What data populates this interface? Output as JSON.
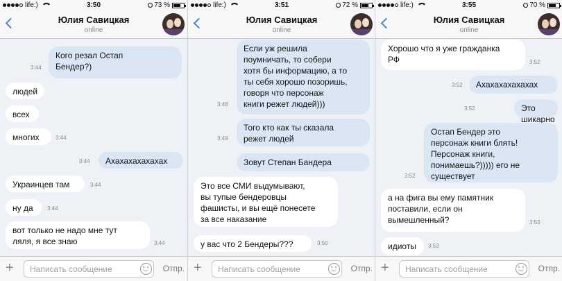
{
  "shared": {
    "contact_name": "Юлия Савицкая",
    "contact_status": "online",
    "carrier": "life:)",
    "input_placeholder": "Написать сообщение",
    "send_label": "Отпр.",
    "plus_glyph": "+",
    "icons": [
      "back-chevron-icon",
      "avatar",
      "add-attachment-icon",
      "emoji-icon",
      "wifi-icon",
      "lock-rotation-icon",
      "battery-icon"
    ],
    "colors": {
      "outgoing_bubble": "#dbe6f4",
      "incoming_bubble": "#ffffff",
      "chat_background": "#eef1f5",
      "accent": "#4a86c5"
    }
  },
  "screens": [
    {
      "clock": "3:50",
      "battery": "73 %",
      "battery_level": 0.73,
      "messages": [
        {
          "dir": "out",
          "text": "Кого резал Остап\nБендер?)",
          "time": "3:44"
        },
        {
          "dir": "in",
          "text": "людей",
          "time": ""
        },
        {
          "dir": "in",
          "text": "всех",
          "time": ""
        },
        {
          "dir": "in",
          "text": "многих",
          "time": "3:44"
        },
        {
          "dir": "out",
          "text": "Ахахахахахахах",
          "time": "3:44"
        },
        {
          "dir": "in",
          "text": "Украинцев там",
          "time": "3:44"
        },
        {
          "dir": "in",
          "text": "ну да",
          "time": "3:44"
        },
        {
          "dir": "in",
          "text": "вот только не надо мне тут\nляля, я все знаю",
          "time": "3:44"
        }
      ]
    },
    {
      "clock": "3:51",
      "battery": "72 %",
      "battery_level": 0.72,
      "messages": [
        {
          "dir": "out",
          "text": "Если уж решила\nпоумничать, то собери\nхотя бы информацию, а то\nты себя хорошо позоришь,\nговоря что персонаж\nкниги режет людей)))",
          "time": "3:48"
        },
        {
          "dir": "out",
          "text": "Того кто как ты сказала\nрежет людей",
          "time": "3:49"
        },
        {
          "dir": "out",
          "text": "Зовут Степан Бандера",
          "time": ""
        },
        {
          "dir": "in",
          "text": "Это все СМИ выдумывают,\nвы тупые бендеровцы\nфашисты, и вы ещё понесете\nза все наказание",
          "time": ""
        },
        {
          "dir": "in",
          "text": "у вас что 2 Бендеры???",
          "time": "3:50"
        }
      ]
    },
    {
      "clock": "3:55",
      "battery": "70 %",
      "battery_level": 0.7,
      "messages": [
        {
          "dir": "in",
          "text": "Хорошо что я уже гражданка\nРФ",
          "time": "3:52"
        },
        {
          "dir": "out",
          "text": "Ахахахахахахах",
          "time": "3:52"
        },
        {
          "dir": "out",
          "text": "Это шикарно",
          "time": "3:52"
        },
        {
          "dir": "out",
          "text": "Остап Бендер это\nперсонаж книги блять!\nПерсонаж книги,\nпонимаешь?))))) его не\nсуществует",
          "time": "3:52"
        },
        {
          "dir": "in",
          "text": "а на фига вы ему памятник\nпоставили, если он\nвымешленный?",
          "time": "3:53"
        },
        {
          "dir": "in",
          "text": "идиоты",
          "time": "3:53"
        }
      ]
    }
  ]
}
